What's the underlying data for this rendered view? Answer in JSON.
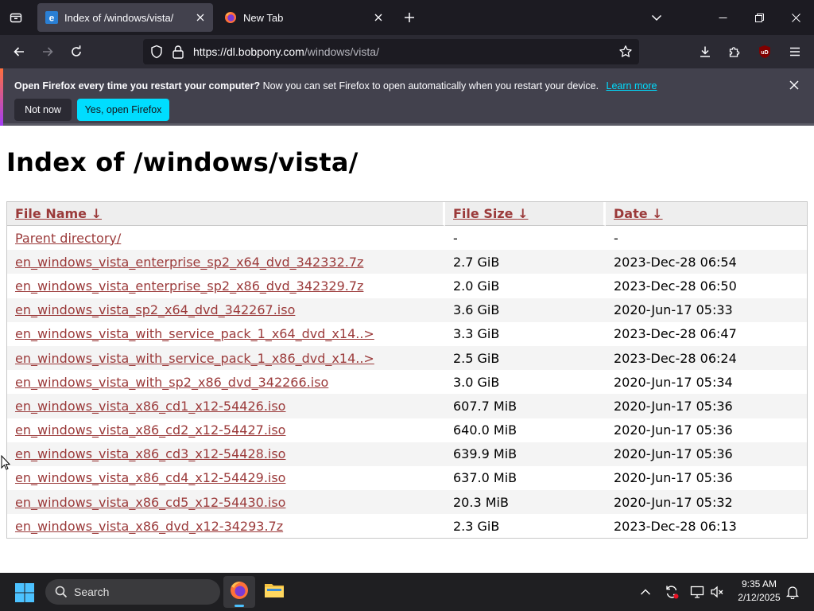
{
  "browser": {
    "tabs": [
      {
        "title": "Index of /windows/vista/",
        "active": true
      },
      {
        "title": "New Tab",
        "active": false
      }
    ],
    "url_host": "https://dl.bobpony.com",
    "url_path": "/windows/vista/"
  },
  "notice": {
    "bold_text": "Open Firefox every time you restart your computer?",
    "text": "Now you can set Firefox to open automatically when you restart your device.",
    "learn_more": "Learn more",
    "not_now": "Not now",
    "yes_open": "Yes, open Firefox"
  },
  "page": {
    "heading": "Index of /windows/vista/",
    "columns": {
      "name": "File Name",
      "size": "File Size",
      "date": "Date",
      "sort_glyph": "↓"
    },
    "rows": [
      {
        "name": "Parent directory/",
        "size": "-",
        "date": "-"
      },
      {
        "name": "en_windows_vista_enterprise_sp2_x64_dvd_342332.7z",
        "size": "2.7 GiB",
        "date": "2023-Dec-28 06:54"
      },
      {
        "name": "en_windows_vista_enterprise_sp2_x86_dvd_342329.7z",
        "size": "2.0 GiB",
        "date": "2023-Dec-28 06:50"
      },
      {
        "name": "en_windows_vista_sp2_x64_dvd_342267.iso",
        "size": "3.6 GiB",
        "date": "2020-Jun-17 05:33"
      },
      {
        "name": "en_windows_vista_with_service_pack_1_x64_dvd_x14..>",
        "size": "3.3 GiB",
        "date": "2023-Dec-28 06:47"
      },
      {
        "name": "en_windows_vista_with_service_pack_1_x86_dvd_x14..>",
        "size": "2.5 GiB",
        "date": "2023-Dec-28 06:24"
      },
      {
        "name": "en_windows_vista_with_sp2_x86_dvd_342266.iso",
        "size": "3.0 GiB",
        "date": "2020-Jun-17 05:34"
      },
      {
        "name": "en_windows_vista_x86_cd1_x12-54426.iso",
        "size": "607.7 MiB",
        "date": "2020-Jun-17 05:36"
      },
      {
        "name": "en_windows_vista_x86_cd2_x12-54427.iso",
        "size": "640.0 MiB",
        "date": "2020-Jun-17 05:36"
      },
      {
        "name": "en_windows_vista_x86_cd3_x12-54428.iso",
        "size": "639.9 MiB",
        "date": "2020-Jun-17 05:36"
      },
      {
        "name": "en_windows_vista_x86_cd4_x12-54429.iso",
        "size": "637.0 MiB",
        "date": "2020-Jun-17 05:36"
      },
      {
        "name": "en_windows_vista_x86_cd5_x12-54430.iso",
        "size": "20.3 MiB",
        "date": "2020-Jun-17 05:32"
      },
      {
        "name": "en_windows_vista_x86_dvd_x12-34293.7z",
        "size": "2.3 GiB",
        "date": "2023-Dec-28 06:13"
      }
    ]
  },
  "taskbar": {
    "search_label": "Search",
    "time": "9:35 AM",
    "date": "2/12/2025"
  },
  "colors": {
    "link": "#9b3a3a",
    "accent_button": "#00ddff",
    "chrome_dark": "#1c1b22"
  },
  "icons": [
    "tab-list-icon",
    "ie-favicon-icon",
    "firefox-favicon-icon",
    "close-icon",
    "plus-icon",
    "chevron-down-icon",
    "minimize-icon",
    "maximize-icon",
    "back-icon",
    "forward-icon",
    "reload-icon",
    "shield-icon",
    "lock-icon",
    "star-icon",
    "download-icon",
    "extensions-icon",
    "ublock-icon",
    "menu-icon",
    "windows-start-icon",
    "search-icon",
    "firefox-icon",
    "file-explorer-icon",
    "chevron-up-icon",
    "sync-icon",
    "network-icon",
    "volume-muted-icon",
    "bell-icon"
  ]
}
